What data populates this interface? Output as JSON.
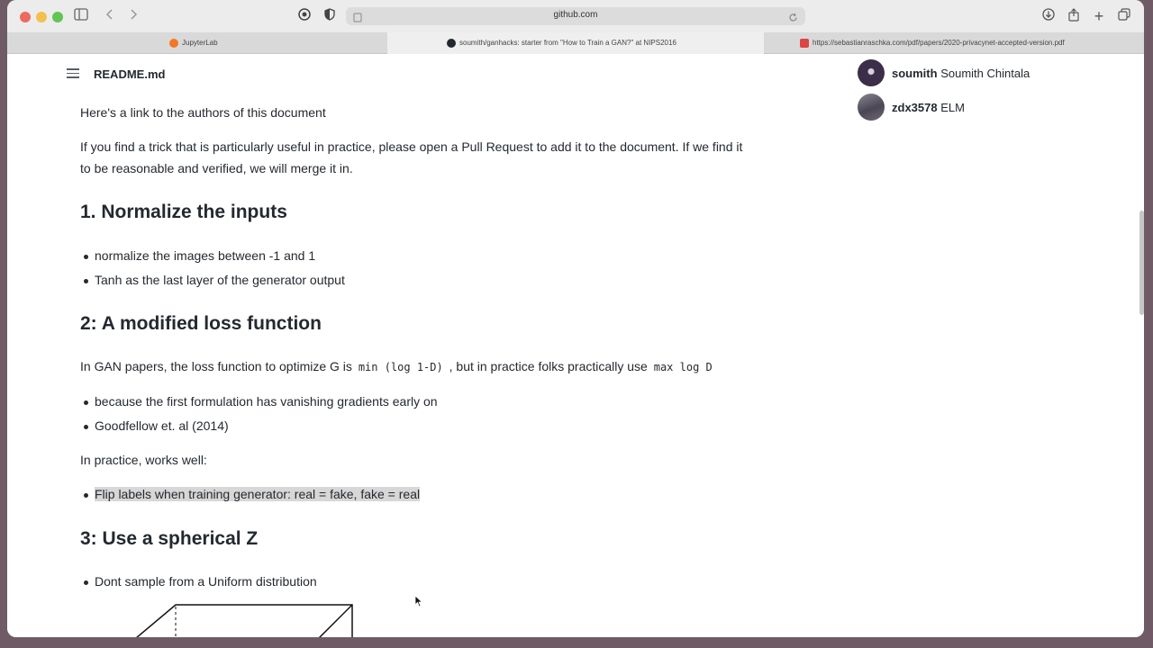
{
  "browser": {
    "url": "github.com",
    "tabs": [
      {
        "label": "JupyterLab"
      },
      {
        "label": "soumith/ganhacks: starter from \"How to Train a GAN?\" at NIPS2016"
      },
      {
        "label": "https://sebastianraschka.com/pdf/papers/2020-privacynet-accepted-version.pdf"
      }
    ]
  },
  "readme": {
    "title": "README.md"
  },
  "contributors": [
    {
      "login": "soumith",
      "name": "Soumith Chintala"
    },
    {
      "login": "zdx3578",
      "name": "ELM"
    }
  ],
  "doc": {
    "p_authors": "Here's a link to the authors of this document",
    "p_trick_1": "If you find a trick that is particularly useful in practice, please open a Pull Request to add it to the document. If we find it",
    "p_trick_2": "to be reasonable and verified, we will merge it in.",
    "h1": "1. Normalize the inputs",
    "s1_items": [
      "normalize the images between -1 and 1",
      "Tanh as the last layer of the generator output"
    ],
    "h2": "2: A modified loss function",
    "s2_intro_a": "In GAN papers, the loss function to optimize G is",
    "s2_code_a": "min (log 1-D)",
    "s2_intro_b": ", but in practice folks practically use",
    "s2_code_b": "max log D",
    "s2_items": [
      "because the first formulation has vanishing gradients early on",
      "Goodfellow et. al (2014)"
    ],
    "s2_practice": "In practice, works well:",
    "s2_highlight": "Flip labels when training generator: real = fake, fake = real",
    "h3": "3: Use a spherical Z",
    "s3_items": [
      "Dont sample from a Uniform distribution"
    ]
  }
}
